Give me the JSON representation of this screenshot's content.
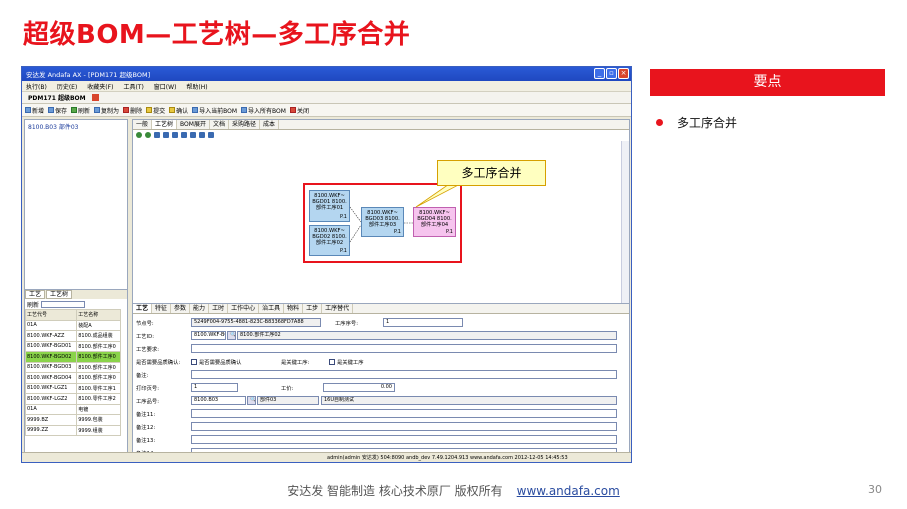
{
  "slide": {
    "title": "超级BOM—工艺树—多工序合并",
    "key_points_header": "要点",
    "key_points": [
      "多工序合并"
    ],
    "footer_text": "安达发  智能制造 核心技术原厂  版权所有",
    "footer_link": "www.andafa.com",
    "page_number": "30",
    "accent_color": "#e8141d"
  },
  "app": {
    "window_title": "安达发 Andafa AX - [PDM171 超级BOM]",
    "menus": [
      "执行(B)",
      "历史(E)",
      "收藏夹(F)",
      "工具(T)",
      "窗口(W)",
      "帮助(H)"
    ],
    "doc_tab": "PDM171 超级BOM",
    "toolbar": [
      "新增",
      "保存",
      "刷新",
      "复制为",
      "删除",
      "提交",
      "确认",
      "导入当前BOM",
      "导入所有BOM",
      "关闭"
    ],
    "tree_root": "8100.B03 部件03",
    "top_tabs": [
      "一般",
      "工艺树",
      "BOM展开",
      "文档",
      "采购路径",
      "成本"
    ],
    "top_active_tab": "工艺树",
    "diagram": {
      "nodes": [
        {
          "text": "8100.WKF~ BGD01 8100.部件工序01",
          "num": "P.1"
        },
        {
          "text": "8100.WKF~ BGD02 8100.部件工序02",
          "num": "P.1"
        },
        {
          "text": "8100.WKF~ BGD03 8100.部件工序03",
          "num": "P.1"
        },
        {
          "text": "8100.WKF~ BGD04 8100.部件工序04",
          "num": "P.1"
        }
      ],
      "callout": "多工序合并"
    },
    "bottom_left_tabs": [
      "工艺",
      "工艺树"
    ],
    "refresh_label": "刷新",
    "grid_headers": [
      "工艺代号",
      "工艺名称"
    ],
    "grid_rows": [
      [
        "01A",
        "装配A"
      ],
      [
        "8100.WKF-AZZ",
        "8100.成品组装"
      ],
      [
        "8100.WKF-BGD01",
        "8100.部件工序0"
      ],
      [
        "8100.WKF-BGD02",
        "8100.部件工序0"
      ],
      [
        "8100.WKF-BGD03",
        "8100.部件工序0"
      ],
      [
        "8100.WKF-BGD04",
        "8100.部件工序0"
      ],
      [
        "8100.WKF-LGZ1",
        "8100.零件工序1"
      ],
      [
        "8100.WKF-LGZ2",
        "8100.零件工序2"
      ],
      [
        "01A",
        "电镀"
      ],
      [
        "9999.BZ",
        "9999.包装"
      ],
      [
        "9999.ZZ",
        "9999.组装"
      ]
    ],
    "selected_row": 3,
    "bottom_tabs": [
      "工艺",
      "特征",
      "参数",
      "能力",
      "工时",
      "工作中心",
      "治工具",
      "物料",
      "工步",
      "工序替代"
    ],
    "form": {
      "node_id_label": "节点号:",
      "node_id": "5249F004-9755-4881-823C-B83368FD7A88",
      "seq_label": "工序序号:",
      "seq": "1",
      "craft_id_label": "工艺ID:",
      "craft_id": "8100.WKF-BG",
      "craft_name": "8100.部件工序02",
      "craft_req_label": "工艺要求:",
      "qc_label": "是否需要品质确认:",
      "qc_text": "是否需要品质确认",
      "key_label": "是关键工序:",
      "key_text": "是关键工序",
      "note_label": "备注:",
      "print_label": "打印页号:",
      "print_value": "1",
      "hours_label": "工价:",
      "hours_value": "0.00",
      "part_label": "工序品号:",
      "part_code": "8100.B03",
      "part_name": "部件03",
      "part_desc": "16U自制测试",
      "note11": "备注11:",
      "note12": "备注12:",
      "note13": "备注13:",
      "note14": "备注14:"
    },
    "status": "admin(admin 安达发)  504:8090  andb_dev  7.49.1204.913  www.andafa.com  2012-12-05 14:45:53"
  }
}
